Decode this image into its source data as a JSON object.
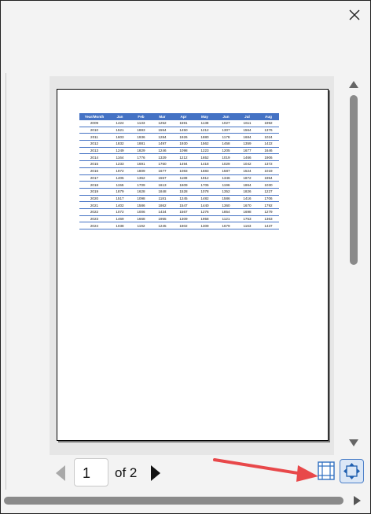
{
  "navigation": {
    "current_page": "1",
    "of_label": "of 2"
  },
  "icons": {
    "close": "close-icon",
    "prev": "previous-page-icon",
    "next": "next-page-icon",
    "margins": "show-margins-icon",
    "zoom": "zoom-to-page-icon",
    "annotation": "red-arrow-annotation"
  },
  "colors": {
    "header_fill": "#4472c4",
    "annotation_red": "#e8484a",
    "zoom_border": "#4b7fc8"
  },
  "sheet": {
    "headers": [
      "Year/Month",
      "Jan",
      "Feb",
      "Mar",
      "Apr",
      "May",
      "Jun",
      "Jul",
      "Aug"
    ],
    "rows": [
      [
        "2009",
        "1424",
        "1133",
        "1252",
        "1591",
        "1138",
        "1027",
        "1611",
        "1992"
      ],
      [
        "2010",
        "1521",
        "1883",
        "1554",
        "1450",
        "1212",
        "1307",
        "1564",
        "1376"
      ],
      [
        "2011",
        "1603",
        "1936",
        "1284",
        "1926",
        "1880",
        "1178",
        "1684",
        "1024"
      ],
      [
        "2012",
        "1832",
        "1881",
        "1497",
        "1930",
        "1562",
        "1458",
        "1359",
        "1422"
      ],
      [
        "2013",
        "1249",
        "1829",
        "1246",
        "1098",
        "1223",
        "1205",
        "1677",
        "1646"
      ],
      [
        "2014",
        "1164",
        "1776",
        "1329",
        "1212",
        "1652",
        "1019",
        "1466",
        "1906"
      ],
      [
        "2015",
        "1233",
        "1691",
        "1760",
        "1494",
        "1418",
        "1029",
        "1042",
        "1372"
      ],
      [
        "2016",
        "1972",
        "1809",
        "1677",
        "1083",
        "1683",
        "1587",
        "1524",
        "1019"
      ],
      [
        "2017",
        "1405",
        "1362",
        "1557",
        "1189",
        "1912",
        "1346",
        "1872",
        "1954"
      ],
      [
        "2018",
        "1155",
        "1709",
        "1613",
        "1609",
        "1705",
        "1196",
        "1864",
        "1030"
      ],
      [
        "2019",
        "1879",
        "1628",
        "1848",
        "1528",
        "1078",
        "1352",
        "1826",
        "1227"
      ],
      [
        "2020",
        "1517",
        "1098",
        "1181",
        "1245",
        "1482",
        "1586",
        "1416",
        "1706"
      ],
      [
        "2021",
        "1402",
        "1586",
        "1862",
        "1547",
        "1440",
        "1360",
        "1670",
        "1792"
      ],
      [
        "2022",
        "1072",
        "1006",
        "1434",
        "1567",
        "1276",
        "1854",
        "1698",
        "1279"
      ],
      [
        "2023",
        "1469",
        "1668",
        "1955",
        "1309",
        "1958",
        "1121",
        "1753",
        "1363"
      ],
      [
        "2024",
        "1038",
        "1192",
        "1245",
        "1802",
        "1309",
        "1679",
        "1163",
        "1437"
      ]
    ]
  }
}
